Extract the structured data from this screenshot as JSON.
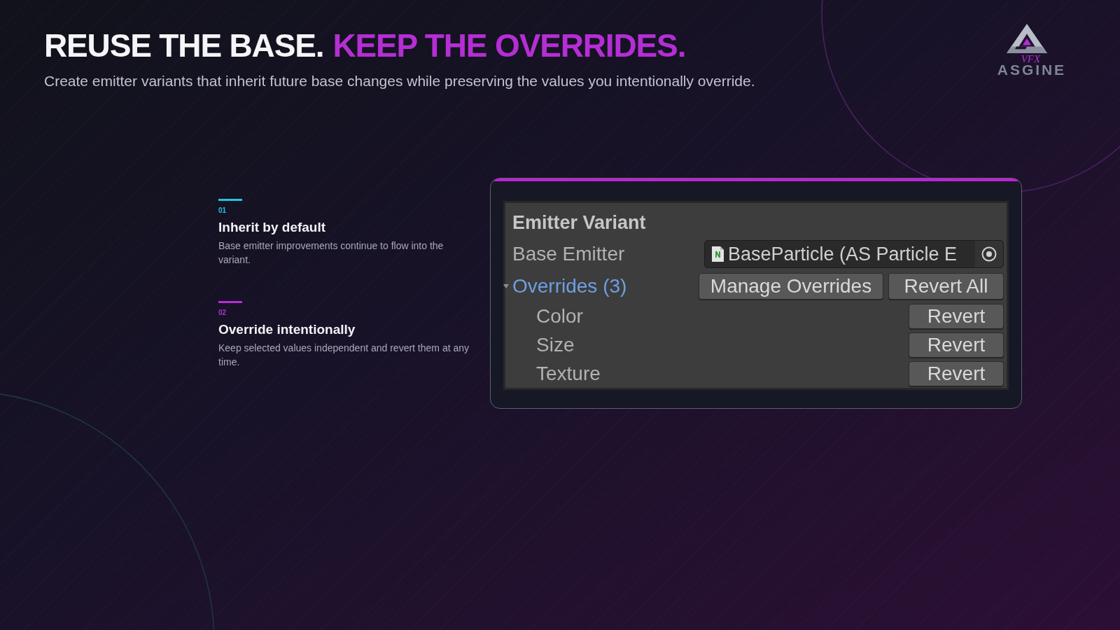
{
  "header": {
    "title": [
      {
        "text": "REUSE THE BASE.",
        "highlighted": false
      },
      {
        "text": "KEEP THE OVERRIDES.",
        "highlighted": true
      }
    ],
    "subtitle": "Create emitter variants that inherit future base changes while preserving the values you intentionally override."
  },
  "logo": {
    "tag": "VFX",
    "name": "ASGINE"
  },
  "points": [
    {
      "number": "01",
      "title": "Inherit by default",
      "description": "Base emitter improvements continue to flow into the variant.",
      "color": "#22c3e3"
    },
    {
      "number": "02",
      "title": "Override intentionally",
      "description": "Keep selected values independent and revert them at any time.",
      "color": "#b52ed4"
    }
  ],
  "inspector": {
    "title": "Emitter Variant",
    "base_emitter": {
      "label": "Base Emitter",
      "value": "BaseParticle (AS Particle E"
    },
    "overrides": {
      "label": "Overrides (3)",
      "expanded": true,
      "buttons": [
        "Manage Overrides",
        "Revert All"
      ],
      "items": [
        {
          "label": "Color",
          "button": "Revert"
        },
        {
          "label": "Size",
          "button": "Revert"
        },
        {
          "label": "Texture",
          "button": "Revert"
        }
      ]
    }
  }
}
